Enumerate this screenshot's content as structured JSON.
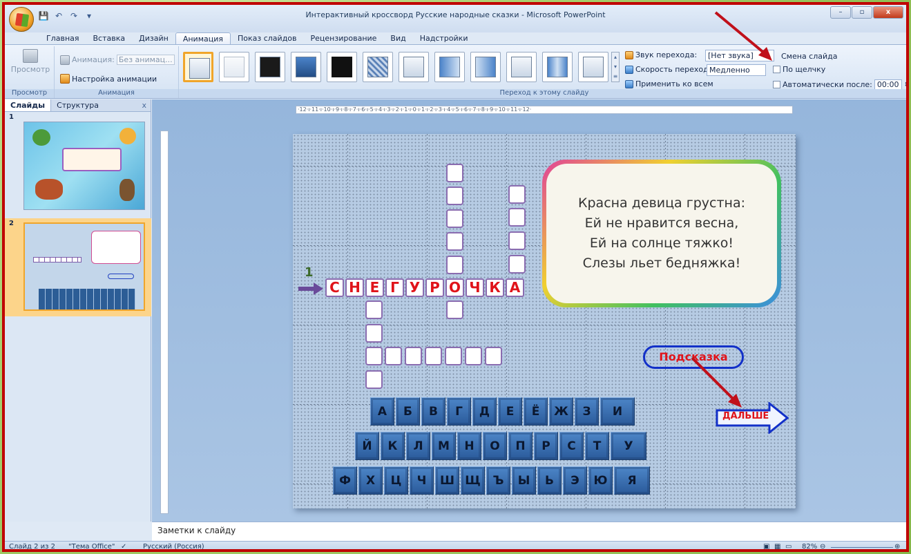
{
  "window": {
    "title": "Интерактивный кроссворд Русские народные сказки - Microsoft PowerPoint"
  },
  "tabs": [
    "Главная",
    "Вставка",
    "Дизайн",
    "Анимация",
    "Показ слайдов",
    "Рецензирование",
    "Вид",
    "Надстройки"
  ],
  "active_tab": "Анимация",
  "ribbon": {
    "preview_label": "Просмотр",
    "preview_group": "Просмотр",
    "animation_label": "Анимация:",
    "animation_value": "Без анимац...",
    "custom_animation": "Настройка анимации",
    "animation_group": "Анимация",
    "transition_group": "Переход к этому слайду",
    "sound_label": "Звук перехода:",
    "sound_value": "[Нет звука]",
    "speed_label": "Скорость перехода:",
    "speed_value": "Медленно",
    "apply_all": "Применить ко всем",
    "advance_title": "Смена слайда",
    "on_click": "По щелчку",
    "auto_after": "Автоматически после:",
    "auto_time": "00:00"
  },
  "pane": {
    "tab_slides": "Слайды",
    "tab_outline": "Структура",
    "close": "x",
    "slide1_num": "1",
    "slide2_num": "2"
  },
  "ruler_text": "·12·ı·11·ı·10·ı·9·ı·8·ı·7·ı·6·ı·5·ı·4·ı·3·ı·2·ı·1·ı·0·ı·1·ı·2·ı·3·ı·4·ı·5·ı·6·ı·7·ı·8·ı·9·ı·10·ı·11·ı·12·",
  "slide": {
    "clue_number": "1",
    "answer_letters": [
      "С",
      "Н",
      "Е",
      "Г",
      "У",
      "Р",
      "О",
      "Ч",
      "К",
      "А"
    ],
    "riddle": {
      "line1": "Красна девица грустна:",
      "line2": "Ей не нравится весна,",
      "line3": "Ей на солнце тяжко!",
      "line4": "Слезы льет бедняжка!"
    },
    "hint_button": "Подсказка",
    "next_button": "ДАЛЬШЕ",
    "keyboard": [
      [
        "А",
        "Б",
        "В",
        "Г",
        "Д",
        "Е",
        "Ё",
        "Ж",
        "З",
        "И"
      ],
      [
        "Й",
        "К",
        "Л",
        "М",
        "Н",
        "О",
        "П",
        "Р",
        "С",
        "Т",
        "У"
      ],
      [
        "Ф",
        "Х",
        "Ц",
        "Ч",
        "Ш",
        "Щ",
        "Ъ",
        "Ы",
        "Ь",
        "Э",
        "Ю",
        "Я"
      ]
    ]
  },
  "notes_placeholder": "Заметки к слайду",
  "status": {
    "slide_info": "Слайд 2 из 2",
    "theme": "\"Тема Office\"",
    "language": "Русский (Россия)",
    "zoom": "82%"
  },
  "colors": {
    "frame": "#c00000",
    "answer_letter": "#e0141a",
    "key_fill": "#2a5a9a",
    "annotation_arrow": "#c0101a"
  }
}
